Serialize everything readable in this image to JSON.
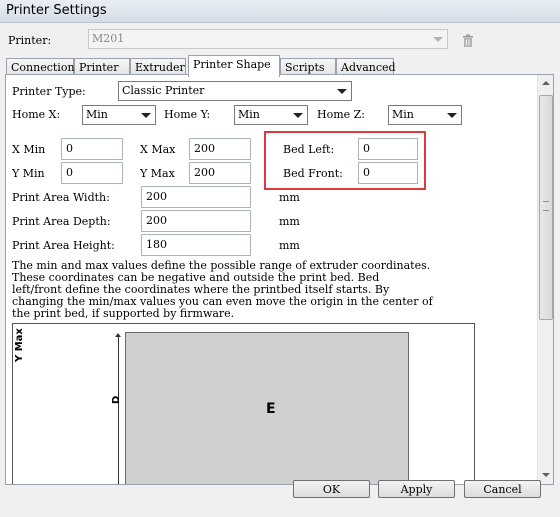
{
  "window": {
    "title": "Printer Settings"
  },
  "printer": {
    "label": "Printer:",
    "value": "M201"
  },
  "tabs": [
    {
      "label": "Connection"
    },
    {
      "label": "Printer"
    },
    {
      "label": "Extruder"
    },
    {
      "label": "Printer Shape"
    },
    {
      "label": "Scripts"
    },
    {
      "label": "Advanced"
    }
  ],
  "shape": {
    "printer_type_label": "Printer Type:",
    "printer_type_value": "Classic Printer",
    "home_x_label": "Home X:",
    "home_x_value": "Min",
    "home_y_label": "Home Y:",
    "home_y_value": "Min",
    "home_z_label": "Home Z:",
    "home_z_value": "Min",
    "x_min_label": "X Min",
    "x_min_value": "0",
    "x_max_label": "X Max",
    "x_max_value": "200",
    "y_min_label": "Y Min",
    "y_min_value": "0",
    "y_max_label": "Y Max",
    "y_max_value": "200",
    "bed_left_label": "Bed Left:",
    "bed_left_value": "0",
    "bed_front_label": "Bed Front:",
    "bed_front_value": "0",
    "area_width_label": "Print Area Width:",
    "area_width_value": "200",
    "area_depth_label": "Print Area Depth:",
    "area_depth_value": "200",
    "area_height_label": "Print Area Height:",
    "area_height_value": "180",
    "unit": "mm",
    "description": "The min and max values define the possible range of extruder coordinates.\nThese coordinates can be negative and outside the print bed. Bed\nleft/front define the coordinates where the printbed itself starts. By\nchanging the min/max values you can even move the origin in the center of\nthe print bed, if supported by firmware."
  },
  "diagram": {
    "y_axis_label": "Y Max",
    "dim_label": "D",
    "bed_label": "E"
  },
  "buttons": {
    "ok": "OK",
    "apply": "Apply",
    "cancel": "Cancel"
  },
  "colors": {
    "highlight": "#e0383e",
    "bed_fill": "#d0d0d0"
  },
  "icons": {
    "trash": "trash-icon"
  }
}
